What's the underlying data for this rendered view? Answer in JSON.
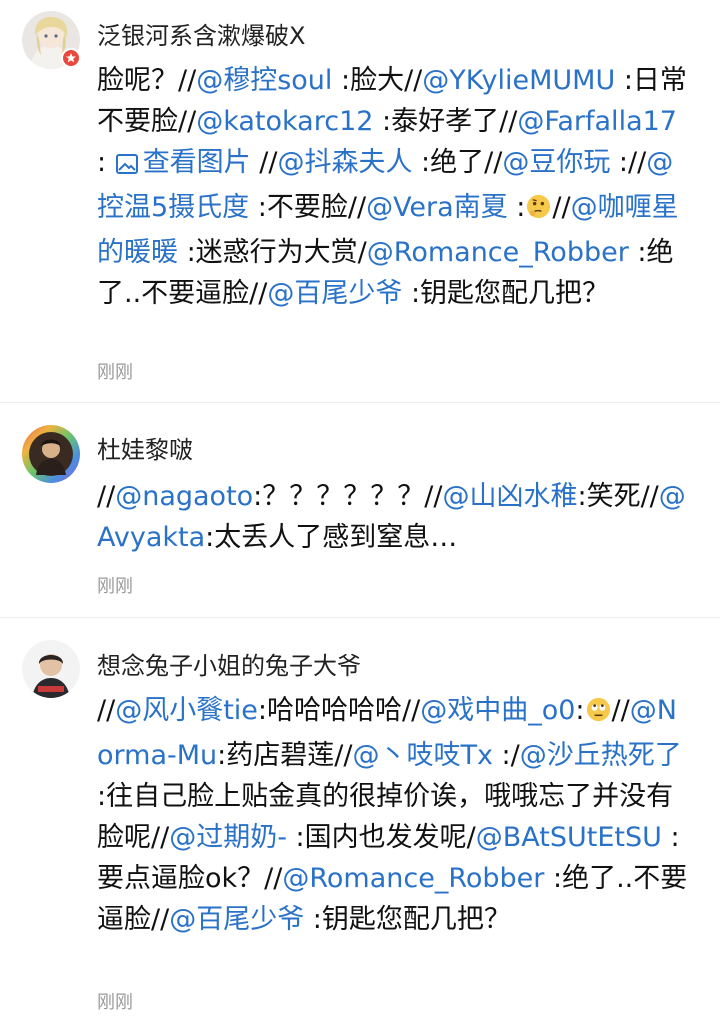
{
  "comments": [
    {
      "author": "泛银河系含漱爆破X",
      "verified": true,
      "time": "刚刚",
      "segments": [
        {
          "t": "text",
          "v": "脸呢？//"
        },
        {
          "t": "mention",
          "v": "@穆控soul"
        },
        {
          "t": "text",
          "v": " :脸大//"
        },
        {
          "t": "mention",
          "v": "@YKylieMUMU"
        },
        {
          "t": "text",
          "v": " :日常不要脸//"
        },
        {
          "t": "mention",
          "v": "@katokarc12"
        },
        {
          "t": "text",
          "v": " :泰好孝了//"
        },
        {
          "t": "mention",
          "v": "@Farfalla17"
        },
        {
          "t": "text",
          "v": " : "
        },
        {
          "t": "image_link",
          "icon": "image-icon",
          "v": "查看图片"
        },
        {
          "t": "text",
          "v": " //"
        },
        {
          "t": "mention",
          "v": "@抖森夫人"
        },
        {
          "t": "text",
          "v": " :绝了//"
        },
        {
          "t": "mention",
          "v": "@豆你玩"
        },
        {
          "t": "text",
          "v": " ://"
        },
        {
          "t": "mention",
          "v": "@控温5摄氏度"
        },
        {
          "t": "text",
          "v": " :不要脸//"
        },
        {
          "t": "mention",
          "v": "@Vera南夏"
        },
        {
          "t": "text",
          "v": " :"
        },
        {
          "t": "emoji",
          "icon": "thinking-face-icon"
        },
        {
          "t": "text",
          "v": "//"
        },
        {
          "t": "mention",
          "v": "@咖喱星的暖暖"
        },
        {
          "t": "text",
          "v": " :迷惑行为大赏/"
        },
        {
          "t": "mention",
          "v": "@Romance_Robber"
        },
        {
          "t": "text",
          "v": " :绝了..不要逼脸//"
        },
        {
          "t": "mention",
          "v": "@百尾少爷"
        },
        {
          "t": "text",
          "v": " :钥匙您配几把？"
        }
      ]
    },
    {
      "author": "杜娃黎啵",
      "verified": false,
      "time": "刚刚",
      "segments": [
        {
          "t": "text",
          "v": "//"
        },
        {
          "t": "mention",
          "v": "@nagaoto"
        },
        {
          "t": "text",
          "v": ":？？？？？？//"
        },
        {
          "t": "mention",
          "v": "@山凶水稚"
        },
        {
          "t": "text",
          "v": ":笑死//"
        },
        {
          "t": "mention",
          "v": "@Avyakta"
        },
        {
          "t": "text",
          "v": ":太丢人了感到窒息…"
        }
      ]
    },
    {
      "author": "想念兔子小姐的兔子大爷",
      "verified": false,
      "time": "刚刚",
      "segments": [
        {
          "t": "text",
          "v": "//"
        },
        {
          "t": "mention",
          "v": "@风小餮tie"
        },
        {
          "t": "text",
          "v": ":哈哈哈哈哈//"
        },
        {
          "t": "mention",
          "v": "@戏中曲_o0"
        },
        {
          "t": "text",
          "v": ":"
        },
        {
          "t": "emoji",
          "icon": "eye-roll-face-icon"
        },
        {
          "t": "text",
          "v": "//"
        },
        {
          "t": "mention",
          "v": "@Norma-Mu"
        },
        {
          "t": "text",
          "v": ":药店碧莲//"
        },
        {
          "t": "mention",
          "v": "@丶吱吱Tx"
        },
        {
          "t": "text",
          "v": " :/"
        },
        {
          "t": "mention",
          "v": "@沙丘热死了"
        },
        {
          "t": "text",
          "v": " :往自己脸上贴金真的很掉价诶，哦哦忘了并没有脸呢//"
        },
        {
          "t": "mention",
          "v": "@过期奶-"
        },
        {
          "t": "text",
          "v": " :国内也发发呢/"
        },
        {
          "t": "mention",
          "v": "@BAtSUtEtSU"
        },
        {
          "t": "text",
          "v": " :要点逼脸ok？//"
        },
        {
          "t": "mention",
          "v": "@Romance_Robber"
        },
        {
          "t": "text",
          "v": " :绝了..不要逼脸//"
        },
        {
          "t": "mention",
          "v": "@百尾少爷"
        },
        {
          "t": "text",
          "v": " :钥匙您配几把？"
        }
      ]
    }
  ],
  "colors": {
    "mention": "#2a72c8",
    "text": "#111111",
    "time": "#9a9a9a",
    "badge": "#e8483e"
  }
}
